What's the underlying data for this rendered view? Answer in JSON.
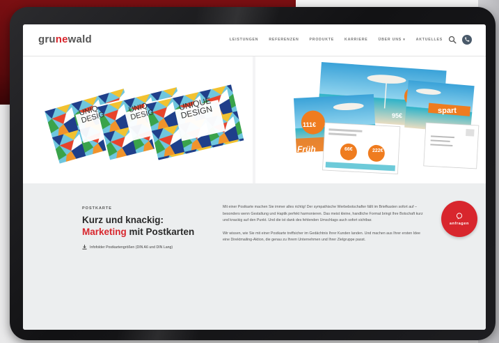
{
  "brand": {
    "logo_pre": "gru",
    "logo_accent": "ne",
    "logo_post": "wald",
    "accent_color": "#d8262d"
  },
  "nav": {
    "items": [
      "LEISTUNGEN",
      "REFERENZEN",
      "PRODUKTE",
      "KARRIERE",
      "ÜBER UNS ▾",
      "AKTUELLES"
    ],
    "search_icon": "search-icon",
    "phone_icon": "phone-icon"
  },
  "hero_left": {
    "cards": [
      {
        "line1": "UNIQ",
        "line2": "DESIG"
      },
      {
        "line1": "UNIQ",
        "line2": "DESIG"
      },
      {
        "line1": "UNIQUE",
        "line2": "DESIGN"
      }
    ]
  },
  "hero_right": {
    "badges": [
      "95€",
      "111€",
      "66€",
      "222€"
    ],
    "word_fru": "Früh",
    "word_spart": "spart"
  },
  "content": {
    "eyebrow": "POSTKARTE",
    "headline_line1": "Kurz und knackig:",
    "headline_red": "Marketing",
    "headline_rest": " mit Postkarten",
    "download_label": "Infofolder Postkartengrößen (DIN A6 und DIN Lang)",
    "paragraph1": "Mit einer Postkarte machen Sie immer alles richtig! Der sympathische Werbebotschafter fällt im Briefkasten sofort auf – besonders wenn Gestaltung und Haptik perfekt harmonieren. Das meist kleine, handliche Format bringt Ihre Botschaft kurz und knackig auf den Punkt. Und die ist dank des fehlenden Umschlags auch sofort sichtbar.",
    "paragraph2": "Wir wissen, wie Sie mit einer Postkarte treffsicher im Gedächtnis Ihrer Kunden landen. Und machen aus Ihrer ersten Idee eine Direktmailing-Aktion, die genau zu Ihrem Unternehmen und Ihrer Zielgruppe passt.",
    "cta_label": "anfragen",
    "cta_icon": "chat-icon"
  }
}
